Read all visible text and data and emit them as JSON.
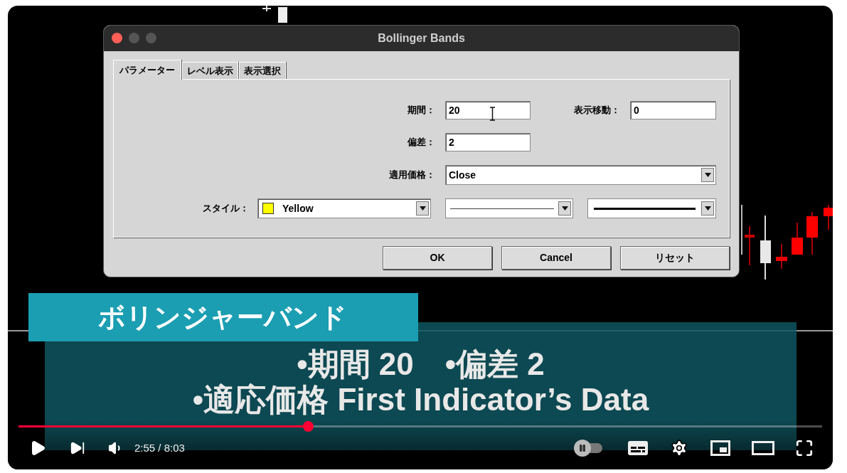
{
  "dialog": {
    "title": "Bollinger Bands",
    "tabs": [
      {
        "label": "パラメーター",
        "selected": true
      },
      {
        "label": "レベル表示",
        "selected": false
      },
      {
        "label": "表示選択",
        "selected": false
      }
    ],
    "period": {
      "label": "期間：",
      "value": "20"
    },
    "shift": {
      "label": "表示移動：",
      "value": "0"
    },
    "deviation": {
      "label": "偏差：",
      "value": "2"
    },
    "applied_price": {
      "label": "適用価格：",
      "value": "Close"
    },
    "style": {
      "label": "スタイル：",
      "color_name": "Yellow",
      "color": "#ffff00"
    },
    "buttons": [
      "OK",
      "Cancel",
      "リセット"
    ]
  },
  "captions": {
    "heading": "ボリンジャーバンド",
    "lines": [
      "•期間 20　•偏差 2",
      "•適応価格 First Indicator’s Data"
    ]
  },
  "player": {
    "progress": {
      "level": 0.36
    },
    "time": "2:55 / 8:03",
    "autoplay": {
      "on": false
    }
  }
}
